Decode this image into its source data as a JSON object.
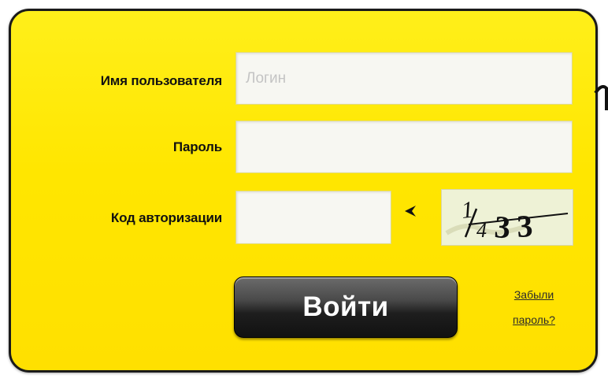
{
  "login_form": {
    "username_label": "Имя пользователя",
    "username_placeholder": "Логин",
    "password_label": "Пароль",
    "auth_code_label": "Код авторизации",
    "captcha_text": "1433",
    "submit_label": "Войти",
    "forgot_line1": "Забыли",
    "forgot_line2": "пароль?"
  },
  "colors": {
    "panel_background": "#ffe600",
    "panel_border": "#1a1a1a",
    "button_background": "#1e1e1e",
    "button_text": "#ffffff"
  },
  "icons": {
    "captcha_pointer": "arrowhead-left-icon"
  }
}
